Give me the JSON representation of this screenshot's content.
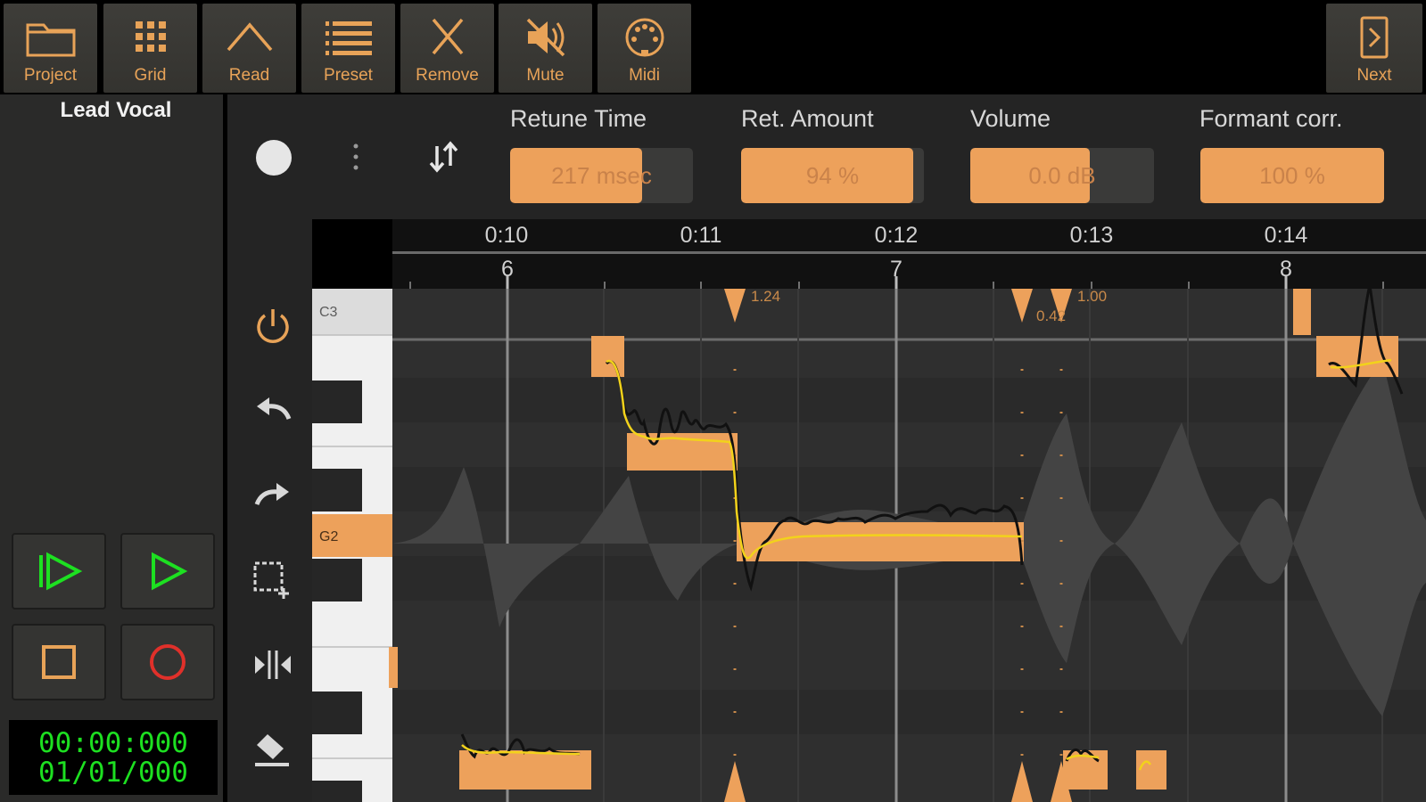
{
  "toolbar": {
    "project": "Project",
    "grid": "Grid",
    "read": "Read",
    "preset": "Preset",
    "remove": "Remove",
    "mute": "Mute",
    "midi": "Midi",
    "next": "Next"
  },
  "track": {
    "name": "Lead Vocal"
  },
  "params": {
    "retune": {
      "label": "Retune Time",
      "value": "217 msec",
      "level": 0.72
    },
    "amount": {
      "label": "Ret. Amount",
      "value": "94 %",
      "level": 0.94
    },
    "volume": {
      "label": "Volume",
      "value": "0.0 dB",
      "level": 0.65
    },
    "formant": {
      "label": "Formant corr.",
      "value": "100 %",
      "level": 1.0
    }
  },
  "timeline": {
    "times": [
      "0:10",
      "0:11",
      "0:12",
      "0:13",
      "0:14"
    ],
    "bars": [
      "6",
      "7",
      "8"
    ]
  },
  "keys": {
    "c3": "C3",
    "g2": "G2"
  },
  "markers": {
    "m1": "1.24",
    "m2": "0.42",
    "m3": "1.00"
  },
  "clock": {
    "time": "00:00:000",
    "position": "01/01/000"
  },
  "colors": {
    "accent": "#eda15b",
    "pitch_curve": "#f2d21b",
    "transport_green": "#1de021",
    "record_red": "#e0302a"
  }
}
